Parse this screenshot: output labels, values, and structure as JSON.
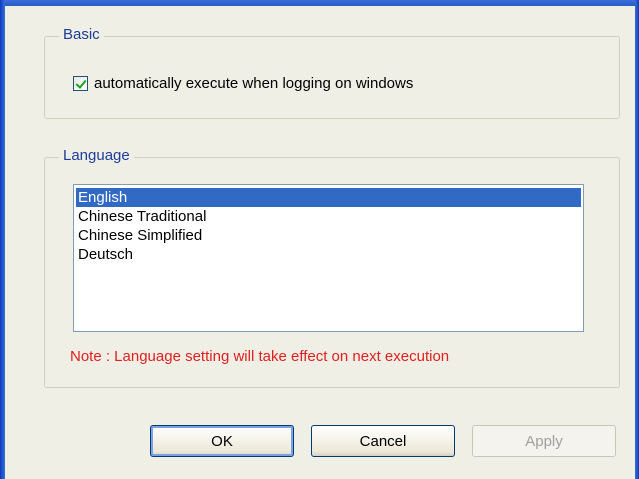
{
  "basic": {
    "legend": "Basic",
    "autostart_label": "automatically execute when logging on windows",
    "autostart_checked": true
  },
  "language": {
    "legend": "Language",
    "items": [
      {
        "label": "English",
        "selected": true
      },
      {
        "label": "Chinese Traditional",
        "selected": false
      },
      {
        "label": "Chinese Simplified",
        "selected": false
      },
      {
        "label": "Deutsch",
        "selected": false
      }
    ],
    "note": "Note : Language setting will take effect on next execution"
  },
  "buttons": {
    "ok": "OK",
    "cancel": "Cancel",
    "apply": "Apply"
  },
  "colors": {
    "note": "#e02020",
    "selection": "#316ac5",
    "legend": "#1c3d9a"
  }
}
